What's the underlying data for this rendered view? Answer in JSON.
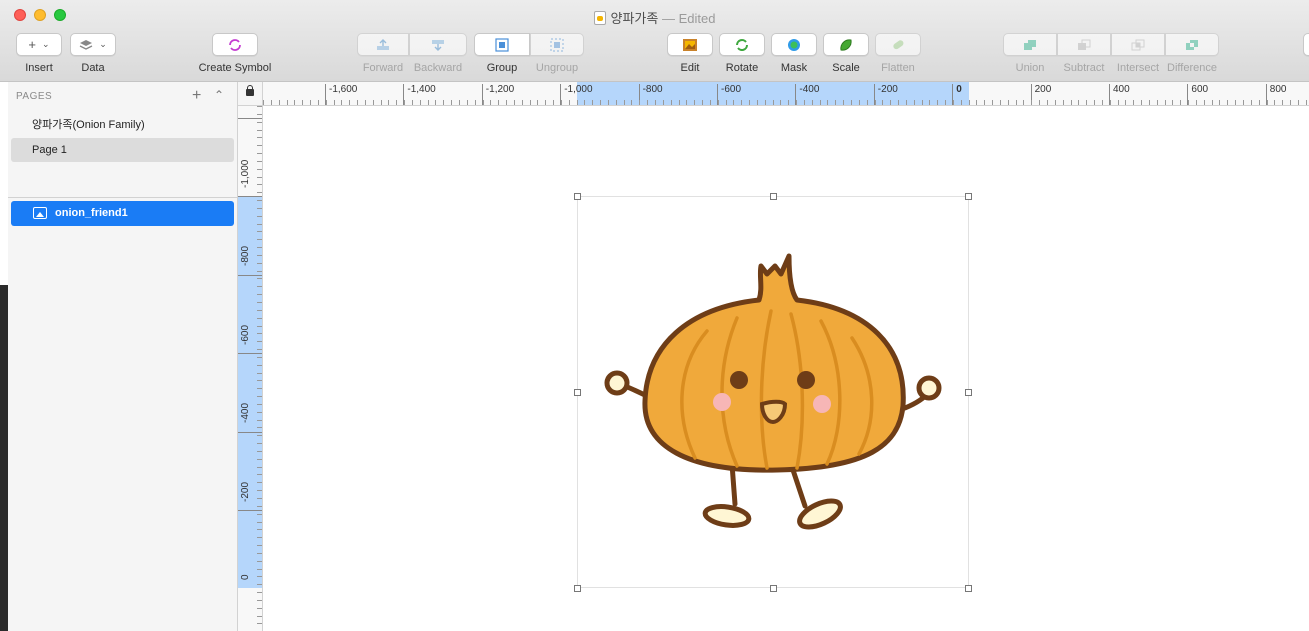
{
  "window": {
    "title": "양파가족",
    "status": "— Edited"
  },
  "toolbar": {
    "insert": "Insert",
    "data": "Data",
    "create_symbol": "Create Symbol",
    "forward": "Forward",
    "backward": "Backward",
    "group": "Group",
    "ungroup": "Ungroup",
    "edit": "Edit",
    "rotate": "Rotate",
    "mask": "Mask",
    "scale": "Scale",
    "flatten": "Flatten",
    "union": "Union",
    "subtract": "Subtract",
    "intersect": "Intersect",
    "difference": "Difference"
  },
  "sidebar": {
    "pages_header": "PAGES",
    "pages": [
      {
        "label": "양파가족(Onion Family)"
      },
      {
        "label": "Page 1"
      }
    ],
    "layers": [
      {
        "label": "onion_friend1"
      }
    ]
  },
  "rulers": {
    "horizontal": [
      "-1,600",
      "-1,400",
      "-1,200",
      "-1,000",
      "-800",
      "-600",
      "-400",
      "-200",
      "0",
      "200",
      "400",
      "600",
      "800"
    ],
    "vertical": [
      "-1,000",
      "-800",
      "-600",
      "-400",
      "-200",
      "0"
    ]
  },
  "colors": {
    "accent": "#1a7cf5",
    "ruler_selection": "#b5d6fb",
    "onion_body": "#f0a93b",
    "onion_outline": "#6e3d17",
    "onion_stripes": "#d98d20",
    "cheeks": "#f7b6b6"
  }
}
